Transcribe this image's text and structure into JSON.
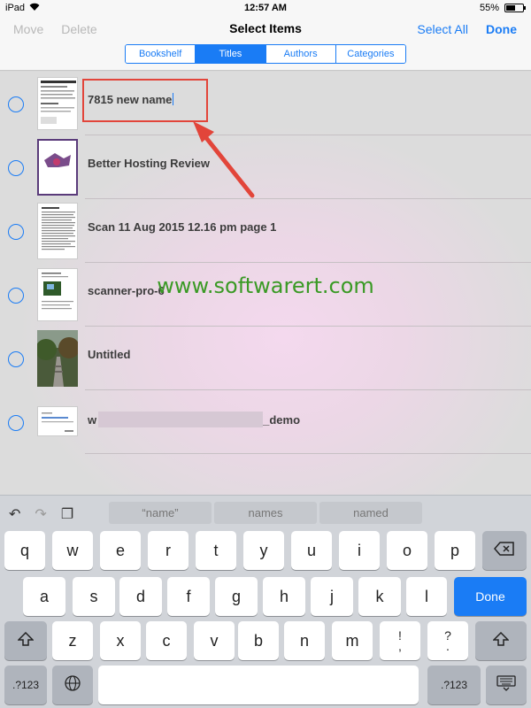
{
  "status": {
    "device": "iPad",
    "time": "12:57 AM",
    "battery": "55%",
    "battery_level": 0.55
  },
  "nav": {
    "move": "Move",
    "delete": "Delete",
    "title": "Select Items",
    "select_all": "Select All",
    "done": "Done",
    "tabs": [
      {
        "label": "Bookshelf",
        "active": false
      },
      {
        "label": "Titles",
        "active": true
      },
      {
        "label": "Authors",
        "active": false
      },
      {
        "label": "Categories",
        "active": false
      }
    ]
  },
  "items": [
    {
      "title": "7815 new name"
    },
    {
      "title": "Better Hosting Review"
    },
    {
      "title": "Scan 11 Aug 2015 12.16 pm page 1"
    },
    {
      "title": "scanner-pro-6"
    },
    {
      "title": "Untitled"
    },
    {
      "title_prefix": "w",
      "title_suffix": "_demo"
    }
  ],
  "watermark": "www.softwarert.com",
  "colors": {
    "accent": "#1a7cf5",
    "highlight": "#e2453a",
    "watermark": "#3a9a25"
  },
  "keyboard": {
    "icons": [
      "undo-icon",
      "redo-icon",
      "paste-icon"
    ],
    "suggestions": [
      "“name”",
      "names",
      "named"
    ],
    "row1": [
      "q",
      "w",
      "e",
      "r",
      "t",
      "y",
      "u",
      "i",
      "o",
      "p"
    ],
    "row2": [
      "a",
      "s",
      "d",
      "f",
      "g",
      "h",
      "j",
      "k",
      "l"
    ],
    "row3": [
      "z",
      "x",
      "c",
      "v",
      "b",
      "n",
      "m"
    ],
    "done": "Done",
    "excl_top": "!",
    "excl_bottom": ",",
    "quest_top": "?",
    "quest_bottom": ".",
    "numkey": ".?123"
  }
}
